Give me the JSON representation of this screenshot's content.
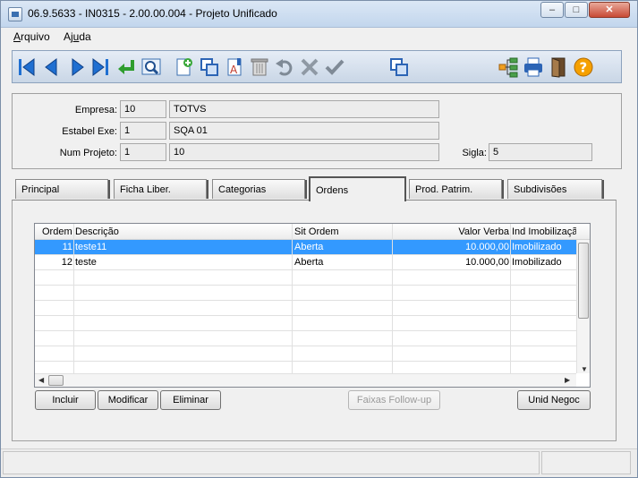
{
  "window": {
    "title": "06.9.5633 - IN0315 - 2.00.00.004 - Projeto Unificado",
    "controls": {
      "minimize": "–",
      "maximize": "□",
      "close": "✕"
    }
  },
  "menu": {
    "items": [
      "Arquivo",
      "Ajuda"
    ]
  },
  "toolbar": {
    "icons": [
      "first-icon",
      "previous-icon",
      "next-icon",
      "last-icon",
      "goto-icon",
      "search-icon",
      "new-icon",
      "copy-icon",
      "edit-icon",
      "delete-icon",
      "undo-icon",
      "cancel-icon",
      "save-icon",
      "duplicate-icon",
      "hierarchy-icon",
      "print-icon",
      "exit-icon",
      "help-icon"
    ]
  },
  "header": {
    "empresa_label": "Empresa:",
    "empresa_code": "10",
    "empresa_name": "TOTVS",
    "estab_label": "Estabel Exe:",
    "estab_code": "1",
    "estab_name": "SQA 01",
    "projeto_label": "Num Projeto:",
    "projeto_code": "1",
    "projeto_num": "10",
    "sigla_label": "Sigla:",
    "sigla_value": "5"
  },
  "tabs": [
    "Principal",
    "Ficha Liber.",
    "Categorias",
    "Ordens",
    "Prod. Patrim.",
    "Subdivisões"
  ],
  "active_tab": "Ordens",
  "grid": {
    "columns": [
      "Ordem",
      "Descrição",
      "Sit Ordem",
      "Valor Verba",
      "Ind Imobilização"
    ],
    "rows": [
      {
        "ordem": "11",
        "descricao": "teste11",
        "sit": "Aberta",
        "valor": "10.000,00",
        "ind": "Imobilizado",
        "selected": true
      },
      {
        "ordem": "12",
        "descricao": "teste",
        "sit": "Aberta",
        "valor": "10.000,00",
        "ind": "Imobilizado",
        "selected": false
      }
    ]
  },
  "buttons": {
    "incluir": "Incluir",
    "modificar": "Modificar",
    "eliminar": "Eliminar",
    "faixas": "Faixas Follow-up",
    "unid": "Unid Negoc"
  }
}
